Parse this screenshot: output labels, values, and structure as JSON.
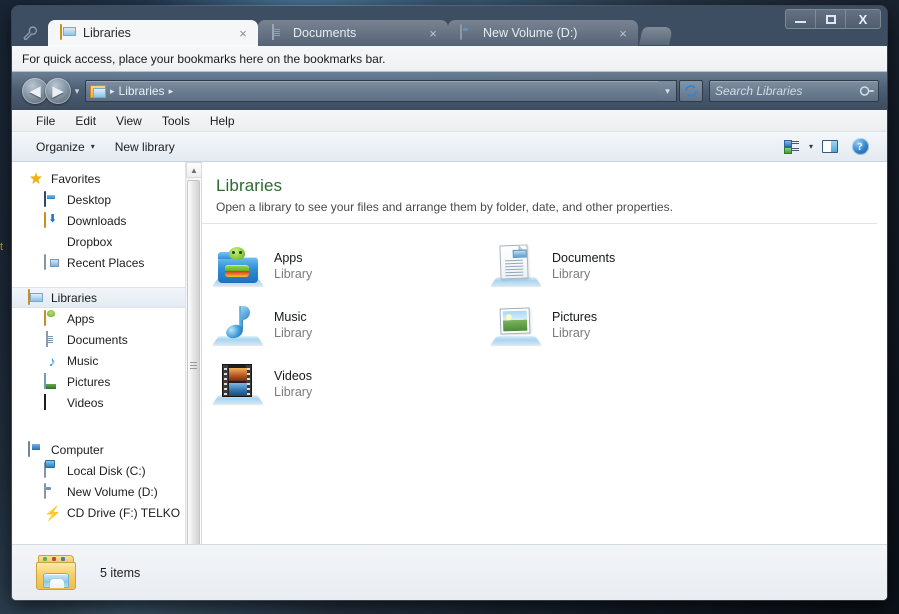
{
  "browser": {
    "tools_icon": "wrench-icon",
    "new_tab_label": "",
    "tabs": [
      {
        "title": "Libraries",
        "icon": "folder-icon",
        "active": true,
        "close": "×"
      },
      {
        "title": "Documents",
        "icon": "document-icon",
        "active": false,
        "close": "×"
      },
      {
        "title": "New Volume (D:)",
        "icon": "drive-icon",
        "active": false,
        "close": "×"
      }
    ],
    "window_controls": {
      "minimize": "minimize-icon",
      "maximize": "maximize-icon",
      "close": "X"
    },
    "bookmarks_bar_text": "For quick access, place your bookmarks here on the bookmarks bar."
  },
  "explorer": {
    "nav": {
      "back": "◀",
      "forward": "▶",
      "history_caret": "▾",
      "breadcrumb_icon": "libraries-folder-icon",
      "breadcrumb": [
        "Libraries"
      ],
      "breadcrumb_sep": "▸",
      "address_dropdown": "▾",
      "refresh_icon": "refresh-icon",
      "search_placeholder": "Search Libraries",
      "search_value": "",
      "search_icon": "search-icon"
    },
    "menubar": [
      "File",
      "Edit",
      "View",
      "Tools",
      "Help"
    ],
    "commandbar": {
      "organize": "Organize",
      "organize_caret": "▾",
      "new_library": "New library",
      "view_icon": "view-layout-icon",
      "view_caret": "▾",
      "preview_pane_icon": "preview-pane-icon",
      "help_icon": "help-icon",
      "help_glyph": "?"
    },
    "sidebar": {
      "groups": [
        {
          "name": "Favorites",
          "icon": "star-icon",
          "selected": false,
          "children": [
            {
              "label": "Desktop",
              "icon": "desktop-icon"
            },
            {
              "label": "Downloads",
              "icon": "downloads-icon"
            },
            {
              "label": "Dropbox",
              "icon": "dropbox-icon"
            },
            {
              "label": "Recent Places",
              "icon": "recent-places-icon"
            }
          ]
        },
        {
          "name": "Libraries",
          "icon": "libraries-folder-icon",
          "selected": true,
          "children": [
            {
              "label": "Apps",
              "icon": "apps-library-icon"
            },
            {
              "label": "Documents",
              "icon": "documents-library-icon"
            },
            {
              "label": "Music",
              "icon": "music-library-icon"
            },
            {
              "label": "Pictures",
              "icon": "pictures-library-icon"
            },
            {
              "label": "Videos",
              "icon": "videos-library-icon"
            }
          ]
        },
        {
          "name": "Computer",
          "icon": "computer-icon",
          "selected": false,
          "children": [
            {
              "label": "Local Disk (C:)",
              "icon": "local-disk-icon"
            },
            {
              "label": "New Volume (D:)",
              "icon": "drive-icon"
            },
            {
              "label": "CD Drive (F:) TELKO",
              "icon": "cd-drive-icon"
            }
          ]
        }
      ],
      "scrollbar": {
        "up": "▲",
        "down": "▼"
      }
    },
    "content": {
      "title": "Libraries",
      "subtitle": "Open a library to see your files and arrange them by folder, date, and other properties.",
      "sub_label": "Library",
      "items": [
        {
          "name": "Apps",
          "sub": "Library",
          "icon": "apps-library-icon"
        },
        {
          "name": "Documents",
          "sub": "Library",
          "icon": "documents-library-icon"
        },
        {
          "name": "Music",
          "sub": "Library",
          "icon": "music-library-icon"
        },
        {
          "name": "Pictures",
          "sub": "Library",
          "icon": "pictures-library-icon"
        },
        {
          "name": "Videos",
          "sub": "Library",
          "icon": "videos-library-icon"
        }
      ]
    },
    "statusbar": {
      "icon": "libraries-stack-icon",
      "text": "5 items"
    }
  },
  "desktop": {
    "edge_text": "t"
  },
  "colors": {
    "title_green": "#2b6b2e",
    "window_chrome": "#3e4e62",
    "selection": "#e3ebf3",
    "accent_blue": "#2f7dc0"
  }
}
